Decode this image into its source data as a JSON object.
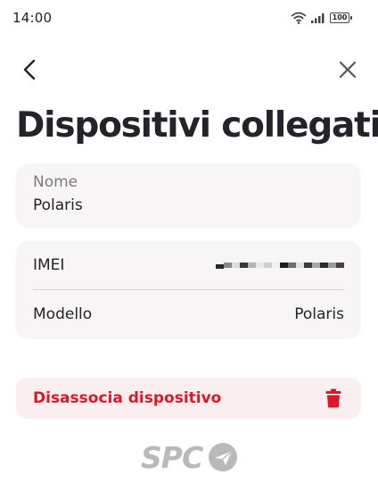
{
  "status_bar": {
    "time": "14:00",
    "battery": "100"
  },
  "nav": {
    "back_icon": "chevron-left-icon",
    "close_icon": "close-icon"
  },
  "page": {
    "title": "Dispositivi collegati"
  },
  "name_card": {
    "label": "Nome",
    "value": "Polaris"
  },
  "info_card": {
    "rows": [
      {
        "label": "IMEI",
        "value": ""
      },
      {
        "label": "Modello",
        "value": "Polaris"
      }
    ]
  },
  "unlink": {
    "label": "Disassocia dispositivo",
    "icon": "trash-icon",
    "color": "#d9182a"
  },
  "brand": {
    "text": "SPC",
    "icon": "plane-badge-icon"
  },
  "colors": {
    "card_bg": "#f7f5f5",
    "danger_bg": "#fbeeee",
    "title": "#23232a"
  }
}
